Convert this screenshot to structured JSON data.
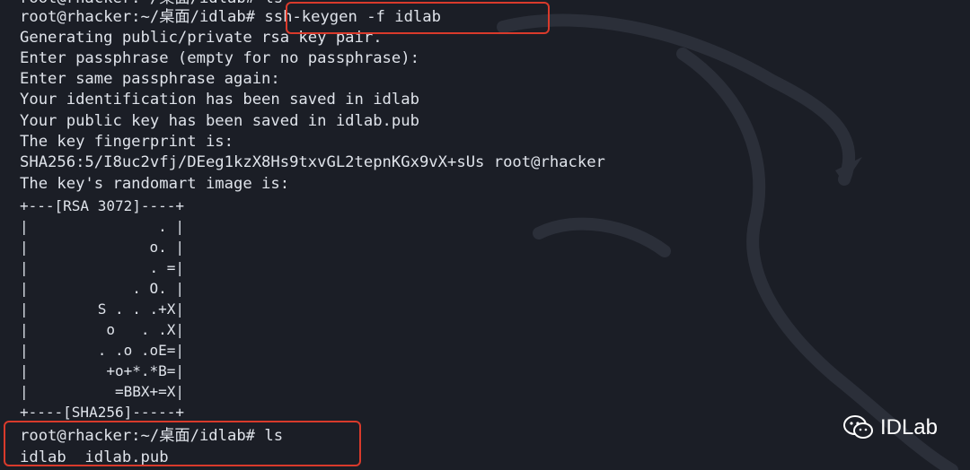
{
  "terminal": {
    "top_line": "root@rhacker:~/桌面/idlab# ls",
    "lines": [
      "root@rhacker:~/桌面/idlab# ssh-keygen -f idlab",
      "Generating public/private rsa key pair.",
      "Enter passphrase (empty for no passphrase):",
      "Enter same passphrase again:",
      "Your identification has been saved in idlab",
      "Your public key has been saved in idlab.pub",
      "The key fingerprint is:",
      "SHA256:5/I8uc2vfj/DEeg1kzX8Hs9txvGL2tepnKGx9vX+sUs root@rhacker",
      "The key's randomart image is:"
    ],
    "randomart": [
      "+---[RSA 3072]----+",
      "|               . |",
      "|              o. |",
      "|              . =|",
      "|            . O. |",
      "|        S . . .+X|",
      "|         o   . .X|",
      "|        . .o .oE=|",
      "|         +o+*.*B=|",
      "|          =BBX+=X|",
      "+----[SHA256]-----+"
    ],
    "after": [
      "root@rhacker:~/桌面/idlab# ls",
      "idlab  idlab.pub"
    ]
  },
  "watermark": {
    "text": "IDLab",
    "icon": "wechat-icon"
  },
  "colors": {
    "background": "#1b1e26",
    "text": "#dfe3ea",
    "highlight": "#d93a2b"
  }
}
